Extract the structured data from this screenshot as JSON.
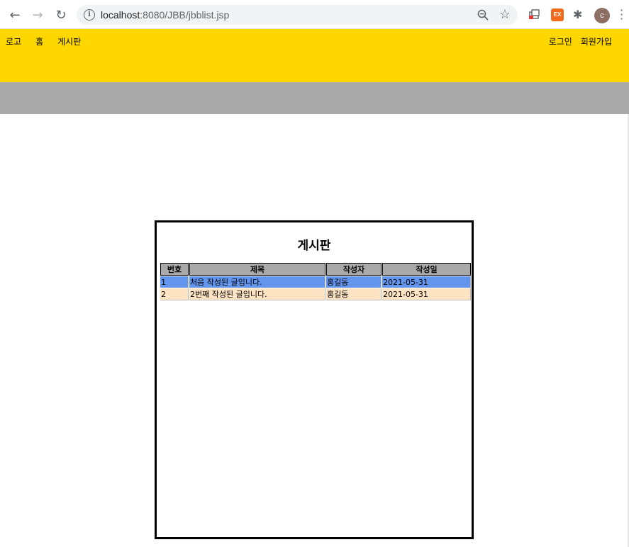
{
  "browser": {
    "url_host": "localhost",
    "url_rest": ":8080/JBB/jbblist.jsp",
    "avatar_letter": "c",
    "ext_label": "EX"
  },
  "header": {
    "nav_left": [
      "로고",
      "홈",
      "게시판"
    ],
    "nav_right": [
      "로그인",
      "회원가입"
    ]
  },
  "board": {
    "title": "게시판",
    "columns": [
      "번호",
      "제목",
      "작성자",
      "작성일"
    ],
    "rows": [
      {
        "no": "1",
        "title": "처음 작성된 글입니다.",
        "author": "홍길동",
        "date": "2021-05-31"
      },
      {
        "no": "2",
        "title": "2번째 작성된 글입니다.",
        "author": "홍길동",
        "date": "2021-05-31"
      }
    ]
  },
  "colors": {
    "header_bg": "#ffd700",
    "subbar_bg": "#aaaaaa",
    "row_highlight": "#6495ed",
    "row_alt": "#ffe4c4"
  }
}
